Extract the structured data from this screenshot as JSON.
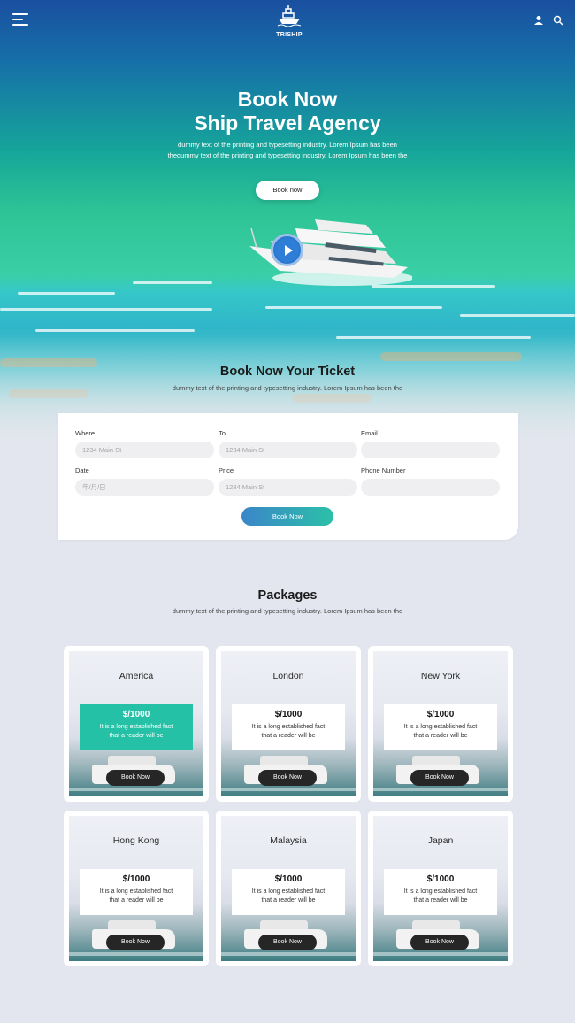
{
  "header": {
    "logo_text": "TRISHIP",
    "menu_icon": "hamburger-icon",
    "user_icon": "user-icon",
    "search_icon": "search-icon"
  },
  "hero": {
    "title_line1": "Book Now",
    "title_line2": "Ship Travel Agency",
    "desc_line1": "dummy text of the printing and typesetting industry. Lorem Ipsum has been",
    "desc_line2": "thedummy text of the printing and typesetting industry. Lorem Ipsum has been the",
    "button_label": "Book now"
  },
  "ticket": {
    "title": "Book Now Your Ticket",
    "desc": "dummy text of the printing and typesetting industry. Lorem Ipsum has been the",
    "fields": {
      "where": {
        "label": "Where",
        "placeholder": "1234 Main St"
      },
      "to": {
        "label": "To",
        "placeholder": "1234 Main St"
      },
      "email": {
        "label": "Email",
        "placeholder": ""
      },
      "date": {
        "label": "Date",
        "placeholder": "年/月/日"
      },
      "price": {
        "label": "Price",
        "placeholder": "1234 Main St"
      },
      "phone": {
        "label": "Phone Number",
        "placeholder": ""
      }
    },
    "submit_label": "Book Now"
  },
  "packages": {
    "title": "Packages",
    "desc": "dummy text of the printing and typesetting industry. Lorem Ipsum has been the",
    "items": [
      {
        "name": "America",
        "price": "$/1000",
        "text": "It is a long established fact that a reader will be",
        "button": "Book Now"
      },
      {
        "name": "London",
        "price": "$/1000",
        "text": "It is a long established fact that a reader will be",
        "button": "Book Now"
      },
      {
        "name": "New York",
        "price": "$/1000",
        "text": "It is a long established fact that a reader will be",
        "button": "Book Now"
      },
      {
        "name": "Hong Kong",
        "price": "$/1000",
        "text": "It is a long established fact that a reader will be",
        "button": "Book Now"
      },
      {
        "name": "Malaysia",
        "price": "$/1000",
        "text": "It is a long established fact that a reader will be",
        "button": "Book Now"
      },
      {
        "name": "Japan",
        "price": "$/1000",
        "text": "It is a long established fact that a reader will be",
        "button": "Book Now"
      }
    ]
  },
  "colors": {
    "accent_teal": "#24c1a6",
    "button_dark": "#262626",
    "hero_top": "#1a4fa0",
    "page_bg": "#e3e6ee"
  }
}
